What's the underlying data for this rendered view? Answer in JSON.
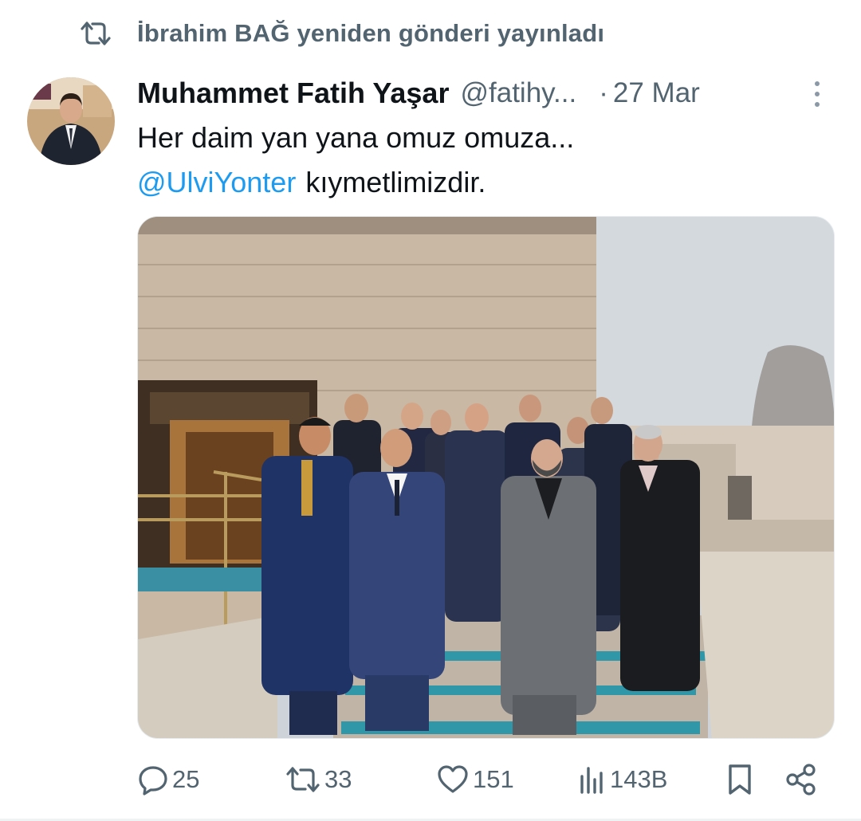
{
  "repost": {
    "icon": "repost-icon",
    "text": "İbrahim BAĞ yeniden gönderi yayınladı"
  },
  "post": {
    "author_name": "Muhammet Fatih Yaşar",
    "author_handle": "@fatihy...",
    "dot": "·",
    "date": "27 Mar",
    "text_line1": "Her daim yan yana omuz omuza...",
    "mention": "@UlviYonter",
    "text_line2_rest": "kıymetlimizdir.",
    "media": "photo"
  },
  "actions": {
    "reply_count": "25",
    "repost_count": "33",
    "like_count": "151",
    "views_count": "143B",
    "icons": [
      "reply-icon",
      "repost-icon",
      "like-icon",
      "views-icon",
      "bookmark-icon",
      "share-icon"
    ]
  },
  "colors": {
    "text": "#0f1419",
    "secondary": "#536471",
    "link": "#1d9bf0",
    "divider": "#eff3f4"
  }
}
